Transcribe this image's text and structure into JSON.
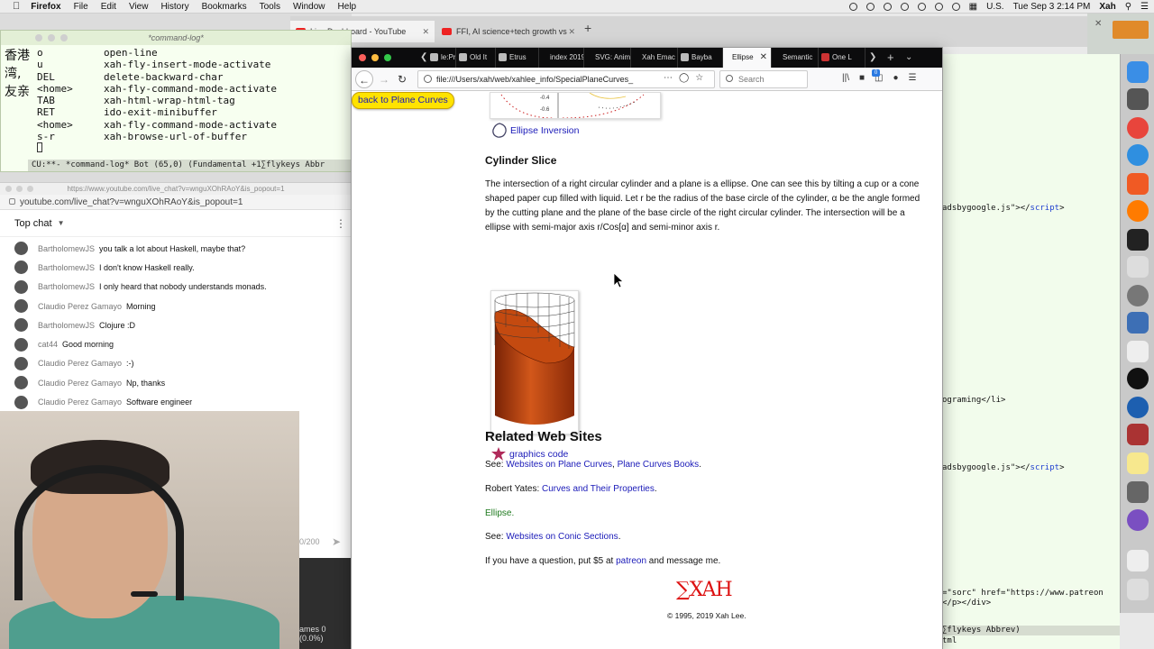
{
  "menubar": {
    "app": "Firefox",
    "items": [
      "File",
      "Edit",
      "View",
      "History",
      "Bookmarks",
      "Tools",
      "Window",
      "Help"
    ],
    "input_source": "U.S.",
    "clock": "Tue Sep 3  2:14 PM",
    "user": "Xah"
  },
  "background_tabs": [
    {
      "label": "Live Dashboard - YouTube"
    },
    {
      "label": "FFI, AI science+tech growth vs"
    }
  ],
  "emacs": {
    "title": "*command-log*",
    "cjk_lines": [
      "香港",
      "湾,",
      "友亲"
    ],
    "log": [
      {
        "key": "o",
        "command": "open-line"
      },
      {
        "key": "u",
        "command": "xah-fly-insert-mode-activate"
      },
      {
        "key": "DEL",
        "command": "delete-backward-char"
      },
      {
        "key": "<home>",
        "command": "xah-fly-command-mode-activate"
      },
      {
        "key": "TAB",
        "command": "xah-html-wrap-html-tag"
      },
      {
        "key": "RET",
        "command": "ido-exit-minibuffer"
      },
      {
        "key": "<home>",
        "command": "xah-fly-command-mode-activate"
      },
      {
        "key": "s-r",
        "command": "xah-browse-url-of-buffer"
      }
    ],
    "modeline": "CU:**-   *command-log*   Bot (65,0)     (Fundamental +1∑flykeys Abbr"
  },
  "chat": {
    "window_title": "https://www.youtube.com/live_chat?v=wnguXOhRAoY&is_popout=1",
    "url": "youtube.com/live_chat?v=wnguXOhRAoY&is_popout=1",
    "header": "Top chat",
    "messages": [
      {
        "author": "BartholomewJS",
        "text": "you talk a lot about Haskell, maybe that?"
      },
      {
        "author": "BartholomewJS",
        "text": "I don't know Haskell really."
      },
      {
        "author": "BartholomewJS",
        "text": "I only heard that nobody understands monads."
      },
      {
        "author": "Claudio Perez Gamayo",
        "text": "Morning"
      },
      {
        "author": "BartholomewJS",
        "text": "Clojure :D"
      },
      {
        "author": "cat44",
        "text": "Good morning"
      },
      {
        "author": "Claudio Perez Gamayo",
        "text": ":-)"
      },
      {
        "author": "Claudio Perez Gamayo",
        "text": "Np, thanks"
      },
      {
        "author": "Claudio Perez Gamayo",
        "text": "Software engineer"
      }
    ],
    "char_count": "0/200",
    "frames": "ames 0 (0.0%)"
  },
  "editor": {
    "lines": [
      {
        "text": "adsbygoogle.js\"></",
        "tag": "script",
        "end": ">"
      },
      {
        "text": "ograming</li>",
        "tag": "",
        "end": ""
      },
      {
        "text": "adsbygoogle.js\"></",
        "tag": "script",
        "end": ">"
      },
      {
        "text": "=\"sorc\" href=\"https://www.patreon",
        "tag": "",
        "end": ""
      },
      {
        "text": "</p></div>",
        "tag": "",
        "end": ""
      }
    ],
    "modeline": "∑flykeys Abbrev)",
    "last": "tml"
  },
  "firefox": {
    "tabs": [
      {
        "label": "le:Pr"
      },
      {
        "label": "Old It"
      },
      {
        "label": "Etrus"
      },
      {
        "label": "index 2019"
      },
      {
        "label": "SVG: Anim"
      },
      {
        "label": "Xah Emac"
      },
      {
        "label": "Bayba"
      },
      {
        "label": "Ellipse"
      },
      {
        "label": "Semantic"
      },
      {
        "label": "One L"
      }
    ],
    "url": "file:///Users/xah/web/xahlee_info/SpecialPlaneCurves_",
    "search_placeholder": "Search",
    "badge": "0"
  },
  "page": {
    "back_button": "back to Plane Curves",
    "plot_ticks": [
      "-0.4",
      "-0.6"
    ],
    "inversion_link": "Ellipse Inversion",
    "cylinder_title": "Cylinder Slice",
    "cylinder_text": "The intersection of a right circular cylinder and a plane is a ellipse. One can see this by tilting a cup or a cone shaped paper cup filled with liquid. Let r be the radius of the base circle of the cylinder, α be the angle formed by the cutting plane and the plane of the base circle of the right circular cylinder. The intersection will be a ellipse with semi-major axis r/Cos[α] and semi-minor axis r.",
    "graphics_link": "graphics code",
    "related_title": "Related Web Sites",
    "see1_prefix": "See: ",
    "see1_link1": "Websites on Plane Curves",
    "see1_sep": ", ",
    "see1_link2": "Plane Curves Books",
    "see1_end": ".",
    "yates_prefix": "Robert Yates: ",
    "yates_link": "Curves and Their Properties",
    "yates_end": ".",
    "ellipse_self": "Ellipse.",
    "see2_prefix": "See: ",
    "see2_link": "Websites on Conic Sections",
    "see2_end": ".",
    "question_prefix": "If you have a question, put $5 at ",
    "question_link": "patreon",
    "question_end": " and message me.",
    "logo": "∑XAH",
    "copyright": "© 1995, 2019 Xah Lee."
  },
  "colors": {
    "link": "#1a1ab8",
    "back_button_bg": "#ffe300",
    "logo_red": "#dd1111",
    "cylinder_top": "#c84a12",
    "cylinder_dark": "#6a1e05"
  }
}
